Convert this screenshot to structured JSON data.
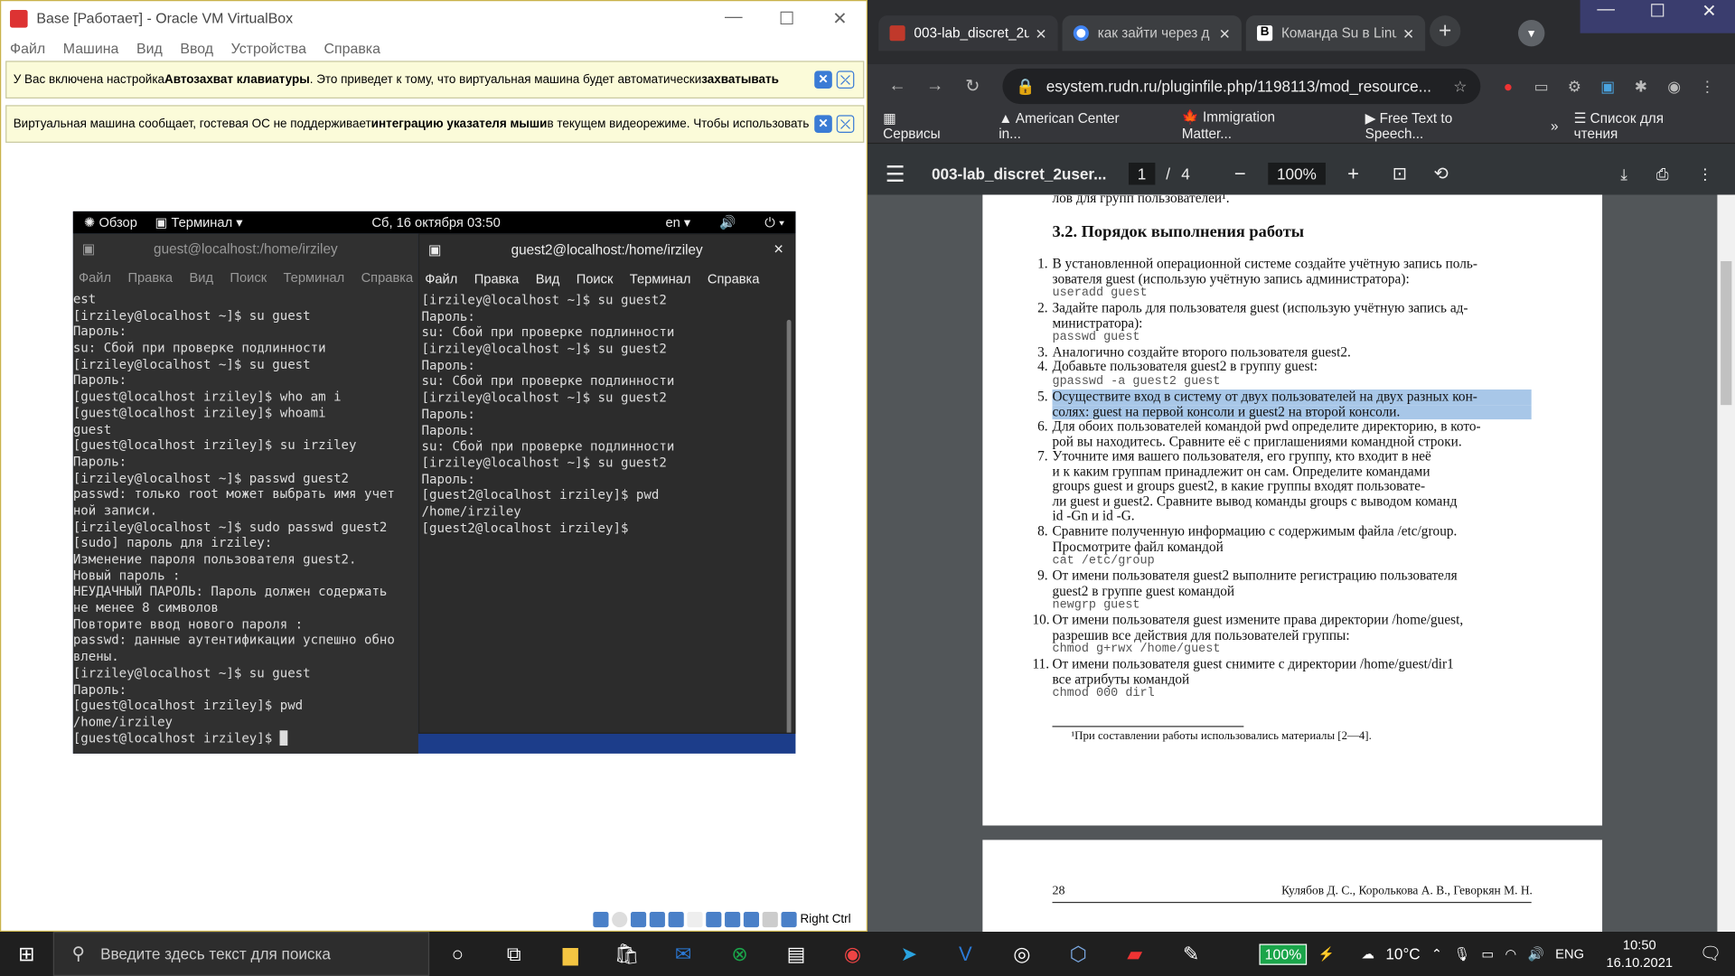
{
  "vbox": {
    "title": "Base [Работает] - Oracle VM VirtualBox",
    "menu": [
      "Файл",
      "Машина",
      "Вид",
      "Ввод",
      "Устройства",
      "Справка"
    ],
    "notice1": {
      "a": "У Вас включена настройка ",
      "b": "Автозахват клавиатуры",
      "c": ". Это приведет к тому, что виртуальная машина будет автоматически ",
      "d": "захватывать"
    },
    "notice2": {
      "a": "Виртуальная машина сообщает, гостевая ОС не поддерживает ",
      "b": "интеграцию указателя мыши",
      "c": " в текущем видеорежиме. Чтобы использовать"
    },
    "host_key": "Right Ctrl"
  },
  "guest": {
    "overview": "Обзор",
    "terminal": "Терминал",
    "datetime": "Сб, 16 октября 03:50",
    "lang": "en",
    "term1": {
      "title": "guest@localhost:/home/irziley",
      "menu": [
        "Файл",
        "Правка",
        "Вид",
        "Поиск",
        "Терминал",
        "Справка"
      ],
      "lines": [
        "est",
        "[irziley@localhost ~]$ su guest",
        "Пароль:",
        "su: Сбой при проверке подлинности",
        "[irziley@localhost ~]$ su guest",
        "Пароль:",
        "[guest@localhost irziley]$ who am i",
        "[guest@localhost irziley]$ whoami",
        "guest",
        "[guest@localhost irziley]$ su irziley",
        "Пароль:",
        "[irziley@localhost ~]$ passwd guest2",
        "passwd: только root может выбрать имя учет",
        "ной записи.",
        "[irziley@localhost ~]$ sudo passwd guest2",
        "[sudo] пароль для irziley:",
        "Изменение пароля пользователя guest2.",
        "Новый пароль :",
        "НЕУДАЧНЫЙ ПАРОЛЬ: Пароль должен содержать",
        "не менее 8 символов",
        "Повторите ввод нового пароля :",
        "passwd: данные аутентификации успешно обно",
        "влены.",
        "[irziley@localhost ~]$ su guest",
        "Пароль:",
        "[guest@localhost irziley]$ pwd",
        "/home/irziley",
        "[guest@localhost irziley]$ █"
      ]
    },
    "term2": {
      "title": "guest2@localhost:/home/irziley",
      "close": "×",
      "menu": [
        "Файл",
        "Правка",
        "Вид",
        "Поиск",
        "Терминал",
        "Справка"
      ],
      "lines": [
        "[irziley@localhost ~]$ su guest2",
        "Пароль:",
        "su: Сбой при проверке подлинности",
        "[irziley@localhost ~]$ su guest2",
        "Пароль:",
        "su: Сбой при проверке подлинности",
        "[irziley@localhost ~]$ su guest2",
        "Пароль:",
        "Пароль:",
        "su: Сбой при проверке подлинности",
        "[irziley@localhost ~]$ su guest2",
        "Пароль:",
        "[guest2@localhost irziley]$ pwd",
        "/home/irziley",
        "[guest2@localhost irziley]$"
      ]
    }
  },
  "chrome": {
    "tabs": [
      {
        "label": "003-lab_discret_2u",
        "color": "#c0392b"
      },
      {
        "label": "как зайти через д",
        "color": "#4285f4"
      },
      {
        "label": "Команда Su в Linu",
        "color": "#222"
      }
    ],
    "url": "esystem.rudn.ru/pluginfile.php/1198113/mod_resource...",
    "bookmarks": [
      "Сервисы",
      "American Center in...",
      "Immigration Matter...",
      "Free Text to Speech..."
    ],
    "reading_list": "Список для чтения",
    "pdf": {
      "name": "003-lab_discret_2user...",
      "page": "1",
      "total": "4",
      "zoom": "100%"
    },
    "doc": {
      "top_frag": "лов для групп пользователей¹.",
      "heading": "3.2.  Порядок выполнения работы",
      "items": [
        {
          "n": "1.",
          "t": "В установленной операционной системе создайте учётную запись поль-",
          "t2": "зователя guest (использую учётную запись администратора):",
          "code": "useradd guest"
        },
        {
          "n": "2.",
          "t": "Задайте пароль для пользователя guest (использую учётную запись ад-",
          "t2": "министратора):",
          "code": "passwd guest"
        },
        {
          "n": "3.",
          "t": "Аналогично создайте второго пользователя guest2."
        },
        {
          "n": "4.",
          "t": "Добавьте пользователя guest2 в группу guest:",
          "code": "gpasswd -a guest2 guest"
        },
        {
          "n": "5.",
          "t": "Осуществите вход в систему от двух пользователей на двух разных кон-",
          "t2": "солях: guest на первой консоли и guest2 на второй консоли."
        },
        {
          "n": "6.",
          "t": "Для обоих пользователей командой pwd определите директорию, в кото-",
          "t2": "рой вы находитесь. Сравните её с приглашениями командной строки."
        },
        {
          "n": "7.",
          "t": "Уточните имя вашего пользователя, его группу, кто входит в неё",
          "t2": "и к каким группам принадлежит он сам. Определите командами",
          "t3": "groups guest и groups guest2, в какие группы входят пользовате-",
          "t4": "ли guest и guest2. Сравните вывод команды groups с выводом команд",
          "t5": "id -Gn и id -G."
        },
        {
          "n": "8.",
          "t": "Сравните полученную информацию с содержимым файла /etc/group.",
          "t2": "Просмотрите файл командой",
          "code": "cat /etc/group"
        },
        {
          "n": "9.",
          "t": "От имени пользователя guest2 выполните регистрацию пользователя",
          "t2": "guest2 в группе guest командой",
          "code": "newgrp guest"
        },
        {
          "n": "10.",
          "t": "От имени пользователя guest измените права директории /home/guest,",
          "t2": "разрешив все действия для пользователей группы:",
          "code": "chmod g+rwx /home/guest"
        },
        {
          "n": "11.",
          "t": "От имени пользователя guest снимите с директории /home/guest/dir1",
          "t2": "все атрибуты командой",
          "code": "chmod 000 dirl"
        }
      ],
      "footnote": "¹При составлении работы использовались материалы [2—4].",
      "page_num": "28",
      "authors": "Кулябов Д. С., Королькова А. В., Геворкян М. Н."
    }
  },
  "taskbar": {
    "search_placeholder": "Введите здесь текст для поиска",
    "battery": "100%",
    "weather": "10°C",
    "lang": "ENG",
    "time": "10:50",
    "date": "16.10.2021"
  }
}
